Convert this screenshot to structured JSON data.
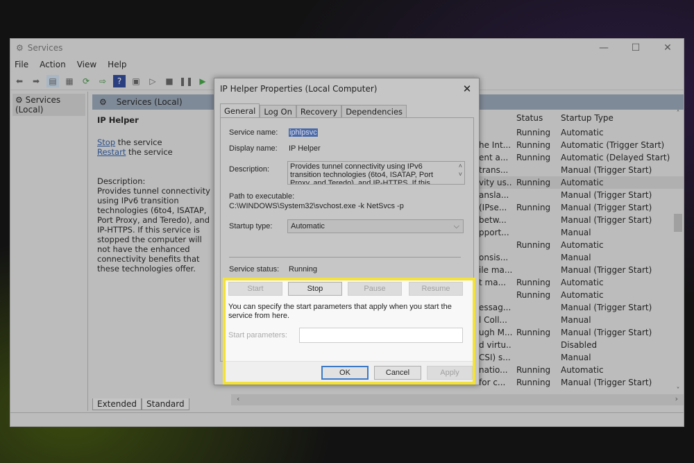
{
  "window": {
    "title": "Services",
    "controls": [
      "—",
      "☐",
      "✕"
    ]
  },
  "menu": [
    "File",
    "Action",
    "View",
    "Help"
  ],
  "toolbar": [
    "back-icon",
    "forward-icon",
    "console-tree-icon",
    "properties-icon",
    "refresh-icon",
    "export-icon",
    "help-icon",
    "action-pane-icon",
    "play-icon",
    "stop-icon",
    "pause-icon",
    "resume-icon"
  ],
  "tree": {
    "root": "Services (Local)"
  },
  "main": {
    "header": "Services (Local)",
    "extended": {
      "title": "IP Helper",
      "stop_link": "Stop",
      "stop_rest": " the service",
      "restart_link": "Restart",
      "restart_rest": " the service",
      "desc_label": "Description:",
      "desc": "Provides tunnel connectivity using IPv6 transition technologies (6to4, ISATAP, Port Proxy, and Teredo), and IP-HTTPS. If this service is stopped the computer will not have the enhanced connectivity benefits that these technologies offer."
    },
    "columns": {
      "status": "Status",
      "startup": "Startup Type"
    },
    "rows": [
      {
        "desc": "",
        "status": "Running",
        "startup": "Automatic"
      },
      {
        "desc": "he Int...",
        "status": "Running",
        "startup": "Automatic (Trigger Start)"
      },
      {
        "desc": "ent a...",
        "status": "Running",
        "startup": "Automatic (Delayed Start)"
      },
      {
        "desc": "trans...",
        "status": "",
        "startup": "Manual (Trigger Start)"
      },
      {
        "desc": "vity us...",
        "status": "Running",
        "startup": "Automatic"
      },
      {
        "desc": "ansla...",
        "status": "",
        "startup": "Manual (Trigger Start)"
      },
      {
        "desc": "(IPse...",
        "status": "Running",
        "startup": "Manual (Trigger Start)"
      },
      {
        "desc": "betw...",
        "status": "",
        "startup": "Manual (Trigger Start)"
      },
      {
        "desc": "pport...",
        "status": "",
        "startup": "Manual"
      },
      {
        "desc": "",
        "status": "Running",
        "startup": "Automatic"
      },
      {
        "desc": "onsis...",
        "status": "",
        "startup": "Manual"
      },
      {
        "desc": "ile ma...",
        "status": "",
        "startup": "Manual (Trigger Start)"
      },
      {
        "desc": "t ma...",
        "status": "Running",
        "startup": "Automatic"
      },
      {
        "desc": "",
        "status": "Running",
        "startup": "Automatic"
      },
      {
        "desc": "essag...",
        "status": "",
        "startup": "Manual (Trigger Start)"
      },
      {
        "desc": "l Coll...",
        "status": "",
        "startup": "Manual"
      },
      {
        "desc": "ugh M...",
        "status": "Running",
        "startup": "Manual (Trigger Start)"
      },
      {
        "desc": "d virtu...",
        "status": "",
        "startup": "Disabled"
      },
      {
        "desc": "CSI) s...",
        "status": "",
        "startup": "Manual"
      },
      {
        "desc": "natio...",
        "status": "Running",
        "startup": "Automatic"
      },
      {
        "desc": "for c...",
        "status": "Running",
        "startup": "Manual (Trigger Start)"
      }
    ],
    "tabs": [
      "Extended",
      "Standard"
    ]
  },
  "dialog": {
    "title": "IP Helper Properties (Local Computer)",
    "tabs": [
      "General",
      "Log On",
      "Recovery",
      "Dependencies"
    ],
    "service_name_label": "Service name:",
    "service_name": "iphlpsvc",
    "display_name_label": "Display name:",
    "display_name": "IP Helper",
    "description_label": "Description:",
    "description": "Provides tunnel connectivity using IPv6 transition technologies (6to4, ISATAP, Port Proxy, and Teredo), and IP-HTTPS. If this service is stopped",
    "path_label": "Path to executable:",
    "path": "C:\\WINDOWS\\System32\\svchost.exe -k NetSvcs -p",
    "startup_label": "Startup type:",
    "startup": "Automatic",
    "status_label": "Service status:",
    "status": "Running",
    "buttons": {
      "start": "Start",
      "stop": "Stop",
      "pause": "Pause",
      "resume": "Resume"
    },
    "hint": "You can specify the start parameters that apply when you start the service from here.",
    "params_label": "Start parameters:",
    "params_value": "",
    "ok": "OK",
    "cancel": "Cancel",
    "apply": "Apply",
    "highlight_color": "#f3e23a"
  }
}
